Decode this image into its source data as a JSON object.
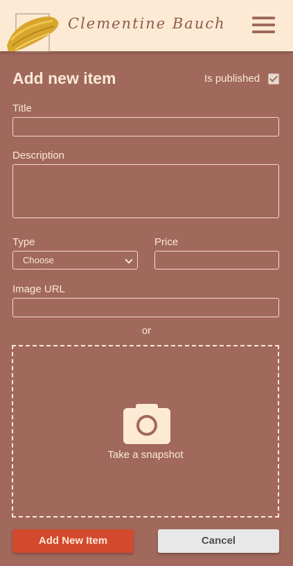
{
  "header": {
    "brand": "Clementine Bauch",
    "logo_icon": "paint-brush-stroke-logo",
    "menu_icon": "hamburger-menu-icon"
  },
  "form": {
    "title": "Add new item",
    "published_label": "Is published",
    "published_checked": true,
    "title_label": "Title",
    "title_value": "",
    "description_label": "Description",
    "description_value": "",
    "type_label": "Type",
    "type_selected": "Choose",
    "price_label": "Price",
    "price_value": "",
    "image_url_label": "Image URL",
    "image_url_value": "",
    "or_text": "or",
    "snapshot_label": "Take a snapshot",
    "snapshot_icon": "camera-icon",
    "add_button": "Add New Item",
    "cancel_button": "Cancel"
  },
  "colors": {
    "background": "#a0695c",
    "header": "#fcead5",
    "text": "#fbe9d8",
    "primary_button": "#d3492d",
    "secondary_button": "#e8e8e8"
  }
}
